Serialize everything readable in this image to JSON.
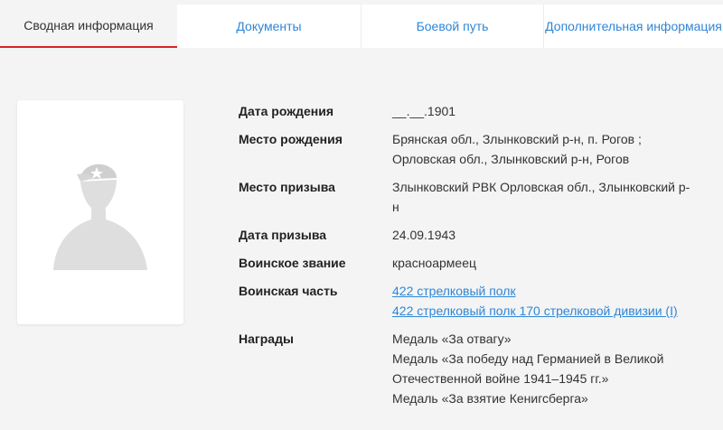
{
  "tabs": [
    {
      "label": "Сводная информация"
    },
    {
      "label": "Документы"
    },
    {
      "label": "Боевой путь"
    },
    {
      "label": "Дополнительная информация"
    }
  ],
  "details": {
    "birth_date": {
      "label": "Дата рождения",
      "value": "__.__.1901"
    },
    "birth_place": {
      "label": "Место рождения",
      "lines": [
        "Брянская обл., Злынковский р-н, п. Рогов ;",
        "Орловская обл., Злынковский р-н, Рогов"
      ]
    },
    "draft_place": {
      "label": "Место призыва",
      "lines": [
        "Злынковский РВК Орловская обл., Злынковский р-",
        "н"
      ]
    },
    "draft_date": {
      "label": "Дата призыва",
      "value": "24.09.1943"
    },
    "rank": {
      "label": "Воинское звание",
      "value": "красноармеец"
    },
    "unit": {
      "label": "Воинская часть",
      "links": [
        "422 стрелковый полк",
        "422 стрелковый полк 170 стрелковой дивизии (I)"
      ]
    },
    "awards": {
      "label": "Награды",
      "lines": [
        "Медаль «За отвагу»",
        "Медаль «За победу над Германией в Великой",
        "Отечественной войне 1941–1945 гг.»",
        "Медаль «За взятие Кенигсберга»"
      ]
    }
  },
  "photo": {
    "icon": "soldier-silhouette-icon"
  }
}
